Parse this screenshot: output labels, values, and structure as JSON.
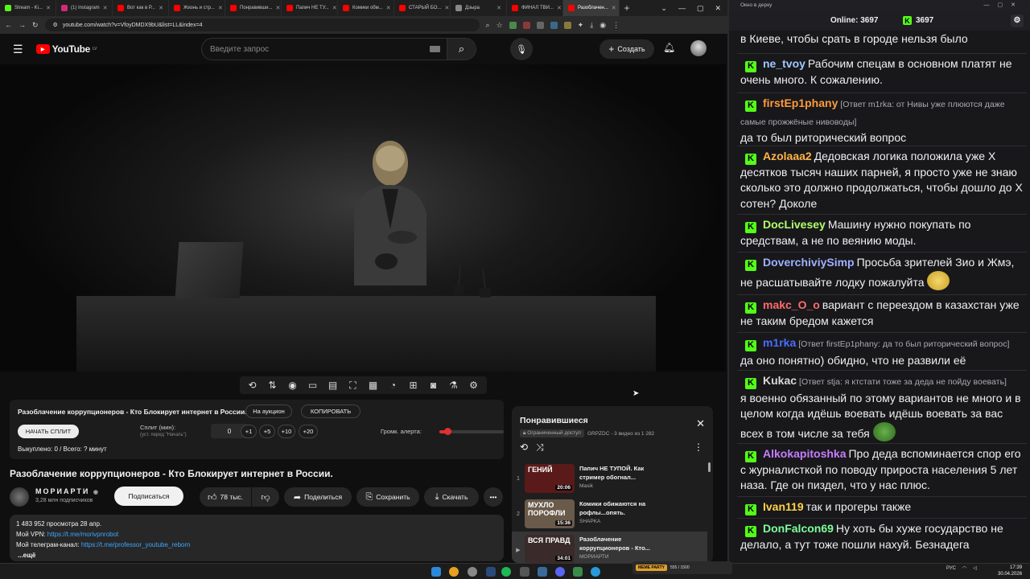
{
  "browser": {
    "tabs": [
      {
        "label": "Stream - Ki...",
        "color": "#53fc18"
      },
      {
        "label": "(1) Instagram",
        "color": "#d62976"
      },
      {
        "label": "Вот как в Р...",
        "color": "#ff0000"
      },
      {
        "label": "Жизнь и стр...",
        "color": "#ff0000"
      },
      {
        "label": "Понравивши...",
        "color": "#ff0000"
      },
      {
        "label": "Папич НЕ ТУ...",
        "color": "#ff0000"
      },
      {
        "label": "Комики обм...",
        "color": "#ff0000"
      },
      {
        "label": "СТАРЫЙ БО...",
        "color": "#ff0000"
      },
      {
        "label": "Дзыра",
        "color": "#888888"
      },
      {
        "label": "ФИНАЛ ТВИ...",
        "color": "#ff0000"
      },
      {
        "label": "Разоблачен...",
        "color": "#ff0000"
      }
    ],
    "url": "youtube.com/watch?v=VfoyDMDX9bU&list=LL&index=4"
  },
  "youtube": {
    "logo": "YouTube",
    "region": "LV",
    "search_placeholder": "Введите запрос",
    "create_label": "Создать"
  },
  "plugin": {
    "video_title": "Разоблачение коррупционеров - Кто Блокирует интернет в России.",
    "auction_label": "На аукцион",
    "copy_label": "КОПИРОВАТЬ",
    "start_split_label": "НАЧАТЬ СПЛИТ",
    "split_label": "Сплит (мин):",
    "split_hint": "(уст. перед \"Начать\")",
    "split_value": "0",
    "increments": [
      "+1",
      "+5",
      "+10",
      "+20"
    ],
    "volume_label": "Громк. алерта:",
    "volume_level": 0.12,
    "bought_text": "Выкуплено: 0 / Всего: ? минут"
  },
  "video": {
    "title": "Разоблачение коррупционеров - Кто Блокирует интернет в России.",
    "channel": "МОРИАРТИ",
    "subscribers": "3,28 млн подписчиков",
    "subscribe_label": "Подписаться",
    "likes": "78 тыс.",
    "share_label": "Поделиться",
    "save_label": "Сохранить",
    "download_label": "Скачать",
    "views_date": "1 483 952 просмотра  28 апр.",
    "vpn_prefix": "Мой VPN: ",
    "vpn_link": "https://t.me/morivpnrobot",
    "tg_prefix": "Мой телеграм-канал: ",
    "tg_link": "https://t.me/professor_youtube_reborn",
    "more_label": "...ещё"
  },
  "playlist": {
    "title": "Понравившиеся",
    "access": "Ограниченный доступ",
    "meta": "GRPZDC - 3 видео из 1 282",
    "items": [
      {
        "index": "1",
        "title": "Папич НЕ ТУПОЙ. Как стример обогнал...",
        "channel": "Masik",
        "duration": "20:06",
        "thumb_text": "ГЕНИЙ",
        "thumb_color": "#5a1a1a"
      },
      {
        "index": "2",
        "title": "Комики обижаются на рофлы...опять.",
        "channel": "SHAPKA",
        "duration": "15:36",
        "thumb_text": "МУХЛО ПОРОФЛИ",
        "thumb_color": "#6a5a4a"
      },
      {
        "index": "▶",
        "title": "Разоблачение коррупционеров - Кто...",
        "channel": "МОРИАРТИ",
        "duration": "34:01",
        "thumb_text": "ВСЯ ПРАВД",
        "thumb_color": "#3a2a2a"
      }
    ]
  },
  "chat": {
    "window_title": "Окно в дерку",
    "online_label": "Online: ",
    "online_count": "3697",
    "kick_count": "3697",
    "messages": [
      {
        "user": "",
        "user_color": "",
        "reply": "",
        "text": "в Киеве, чтобы срать в городе нельзя было"
      },
      {
        "user": "ne_tvoy",
        "user_color": "#a0c8ff",
        "reply": "",
        "text": "Рабочим спецам в основном платят не очень много. К сожалению."
      },
      {
        "user": "firstEp1phany",
        "user_color": "#ff9a3c",
        "reply": "[Ответ m1rka: от Нивы уже плюются даже самые прожжёные нивоводы]",
        "text": "да то был риторический вопрос"
      },
      {
        "user": "Azolaaa2",
        "user_color": "#ffb347",
        "reply": "",
        "text": "Дедовская логика положила уже Х десятков тысяч наших парней, я просто уже не знаю сколько это должно продолжаться, чтобы дошло до Х сотен? Доколе"
      },
      {
        "user": "DocLivesey",
        "user_color": "#b4ff6e",
        "reply": "",
        "text": "Машину нужно покупать по средствам, а не по веянию моды."
      },
      {
        "user": "DoverchiviySimp",
        "user_color": "#9fb0ff",
        "reply": "",
        "text": "Просьба зрителей Зио и Жмэ, не расшатывайте лодку пожалуйта"
      },
      {
        "user": "makc_O_o",
        "user_color": "#ff6b6b",
        "reply": "",
        "text": "вариант с переездом в казахстан уже не таким бредом кажется"
      },
      {
        "user": "m1rka",
        "user_color": "#4a6cff",
        "reply": "[Ответ firstEp1phany: да то был риторический вопрос]",
        "text": "да оно понятно) обидно, что не развили её"
      },
      {
        "user": "Kukac",
        "user_color": "#d8d8d8",
        "reply": "[Ответ stja: я ктстати тоже за деда не пойду воевать]",
        "text": "я военно обязанный по этому вариантов не много и в целом когда идёшь воевать идёшь воевать за вас всех в том числе за тебя"
      },
      {
        "user": "Alkokapitoshka",
        "user_color": "#c77dff",
        "reply": "",
        "text": "Про деда вспоминается спор его с журналисткой по поводу прироста населения 5 лет наза. Где он пиздел, что у нас плюс."
      },
      {
        "user": "Ivan119",
        "user_color": "#ffd24a",
        "reply": "",
        "text": "так и прогеры также"
      },
      {
        "user": "DonFalcon69",
        "user_color": "#7dff9a",
        "reply": "",
        "text": "Ну хоть бы хуже государство не делало, а тут тоже пошли нахуй. Безнадега"
      }
    ]
  },
  "taskbar": {
    "lang": "РУС",
    "time": "17:39",
    "date": "30.04.2026",
    "widget_label": "MEME PARTY",
    "widget_value": "555 / 1500"
  }
}
